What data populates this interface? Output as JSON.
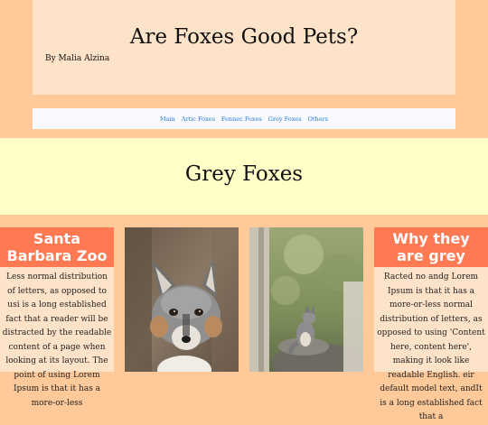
{
  "header": {
    "title": "Are Foxes Good Pets?",
    "byline": "By Malia Alzina"
  },
  "nav": {
    "items": [
      "Main",
      "Artic Foxes",
      "Fennec Foxes",
      "Grey Foxes",
      "Others"
    ]
  },
  "section": {
    "title": "Grey Foxes"
  },
  "cards": {
    "left": {
      "heading": "Santa Barbara Zoo",
      "text": "Less normal distribution of letters, as opposed to usi is a long established fact that a reader will be distracted by the readable content of a page when looking at its layout. The point of using Lorem Ipsum is that it has a more-or-less"
    },
    "right": {
      "heading": "Why they are grey",
      "text": "Racted no andg Lorem Ipsum is that it has a more-or-less normal distribution of letters, as opposed to using 'Content here, content here', making it look like readable English. eir default model text, andIt is a long established fact that a"
    }
  },
  "photos": {
    "photo1": "grey-fox-closeup-photo",
    "photo2": "grey-fox-on-rock-photo"
  },
  "colors": {
    "page_bg": "#ffc999",
    "header_bg": "#ffe3c9",
    "nav_bg": "#f7f9fc",
    "nav_link": "#2a7bd6",
    "section_bg": "#ffffc7",
    "card_head": "#ff7a52"
  }
}
